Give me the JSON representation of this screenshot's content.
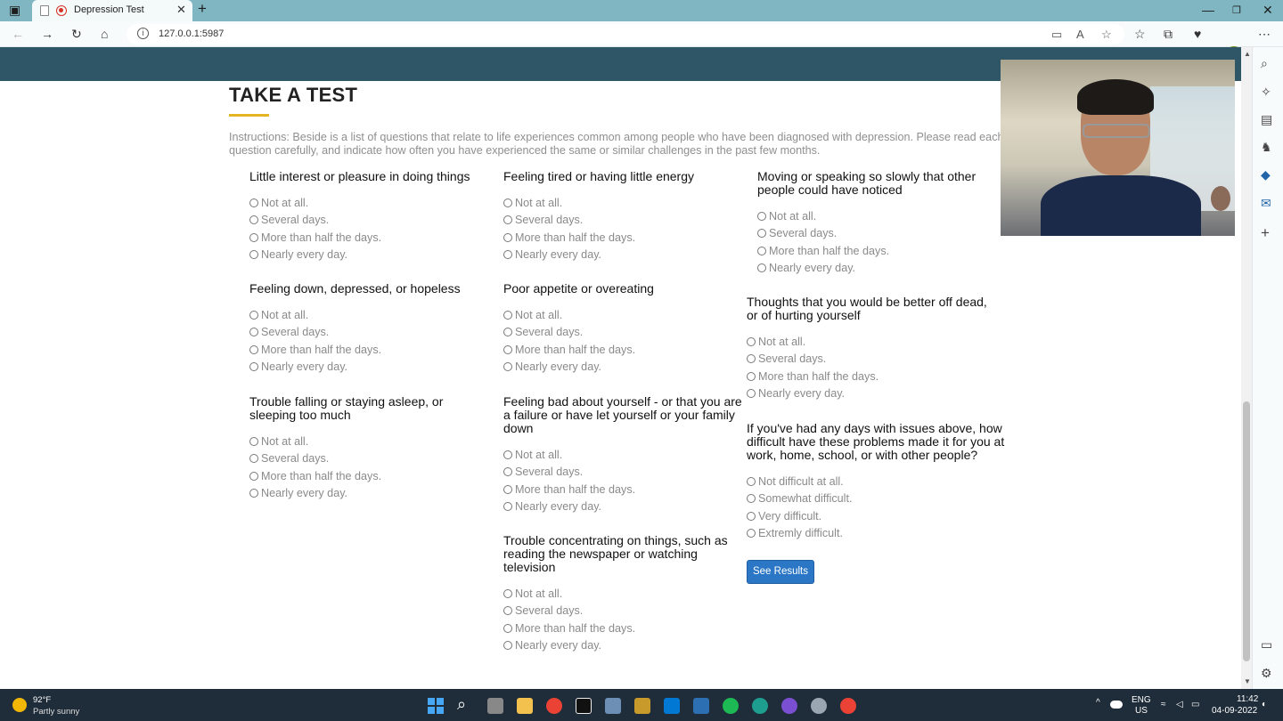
{
  "browser": {
    "tab_title": "Depression Test",
    "url": "127.0.0.1:5987"
  },
  "page": {
    "title": "TAKE A TEST",
    "instructions": "Instructions: Beside is a list of questions that relate to life experiences common among people who have been diagnosed with depression. Please read each question carefully, and indicate how often you have experienced the same or similar challenges in the past few months."
  },
  "options": [
    "Not at all.",
    "Several days.",
    "More than half the days.",
    "Nearly every day."
  ],
  "difficulty_options": [
    "Not difficult at all.",
    "Somewhat difficult.",
    "Very difficult.",
    "Extremly difficult."
  ],
  "questions": [
    "Little interest or pleasure in doing things",
    "Feeling down, depressed, or hopeless",
    "Trouble falling or staying asleep, or sleeping too much",
    "Feeling tired or having little energy",
    "Poor appetite or overeating",
    "Feeling bad about yourself - or that you are a failure or have let yourself or your family down",
    "Trouble concentrating on things, such as reading the newspaper or watching television",
    "Moving or speaking so slowly that other people could have noticed",
    "Thoughts that you would be better off dead, or of hurting yourself",
    "If you've had any days with issues above, how difficult have these problems made it for you at work, home, school, or with other people?"
  ],
  "submit_label": "See Results",
  "taskbar": {
    "temperature": "92°F",
    "weather": "Partly sunny",
    "lang": "ENG",
    "region": "US",
    "time": "11:42",
    "date": "04-09-2022"
  },
  "colors": {
    "header_band": "#2f5667",
    "accent_underline": "#e4b522",
    "button": "#2b77c6"
  }
}
